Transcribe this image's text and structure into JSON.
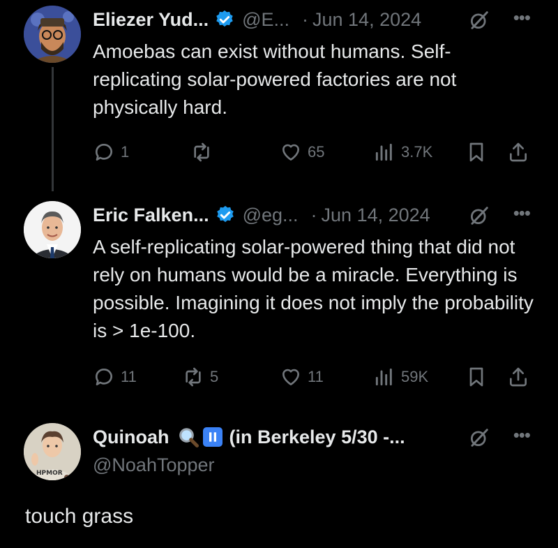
{
  "tweets": [
    {
      "name": "Eliezer Yud...",
      "handle": "@E...",
      "date": "Jun 14, 2024",
      "text": "Amoebas can exist without humans.  Self-replicating solar-powered factories are not physically hard.",
      "replies": "1",
      "retweets": "",
      "likes": "65",
      "views": "3.7K",
      "avatar_color": "#2a3a7a"
    },
    {
      "name": "Eric Falken...",
      "handle": "@eg...",
      "date": "Jun 14, 2024",
      "text": "A self-replicating solar-powered thing that did not rely on humans would be a miracle. Everything is possible. Imagining it does not imply the probability is > 1e-100.",
      "replies": "11",
      "retweets": "5",
      "likes": "11",
      "views": "59K",
      "avatar_color": "#f2f2f2"
    }
  ],
  "reply": {
    "name": "Quinoah",
    "name_suffix": "(in Berkeley 5/30 -...",
    "handle": "@NoahTopper",
    "text": "touch grass",
    "shirt_text": "HPMOR"
  },
  "icons": {
    "verified": "verified-badge-icon",
    "grok": "grok-icon",
    "more": "more-icon",
    "reply": "reply-icon",
    "retweet": "retweet-icon",
    "like": "like-icon",
    "views": "views-icon",
    "bookmark": "bookmark-icon",
    "share": "share-icon"
  },
  "colors": {
    "verified": "#1d9bf0",
    "muted": "#71767b",
    "text": "#e7e9ea",
    "background": "#000000"
  }
}
